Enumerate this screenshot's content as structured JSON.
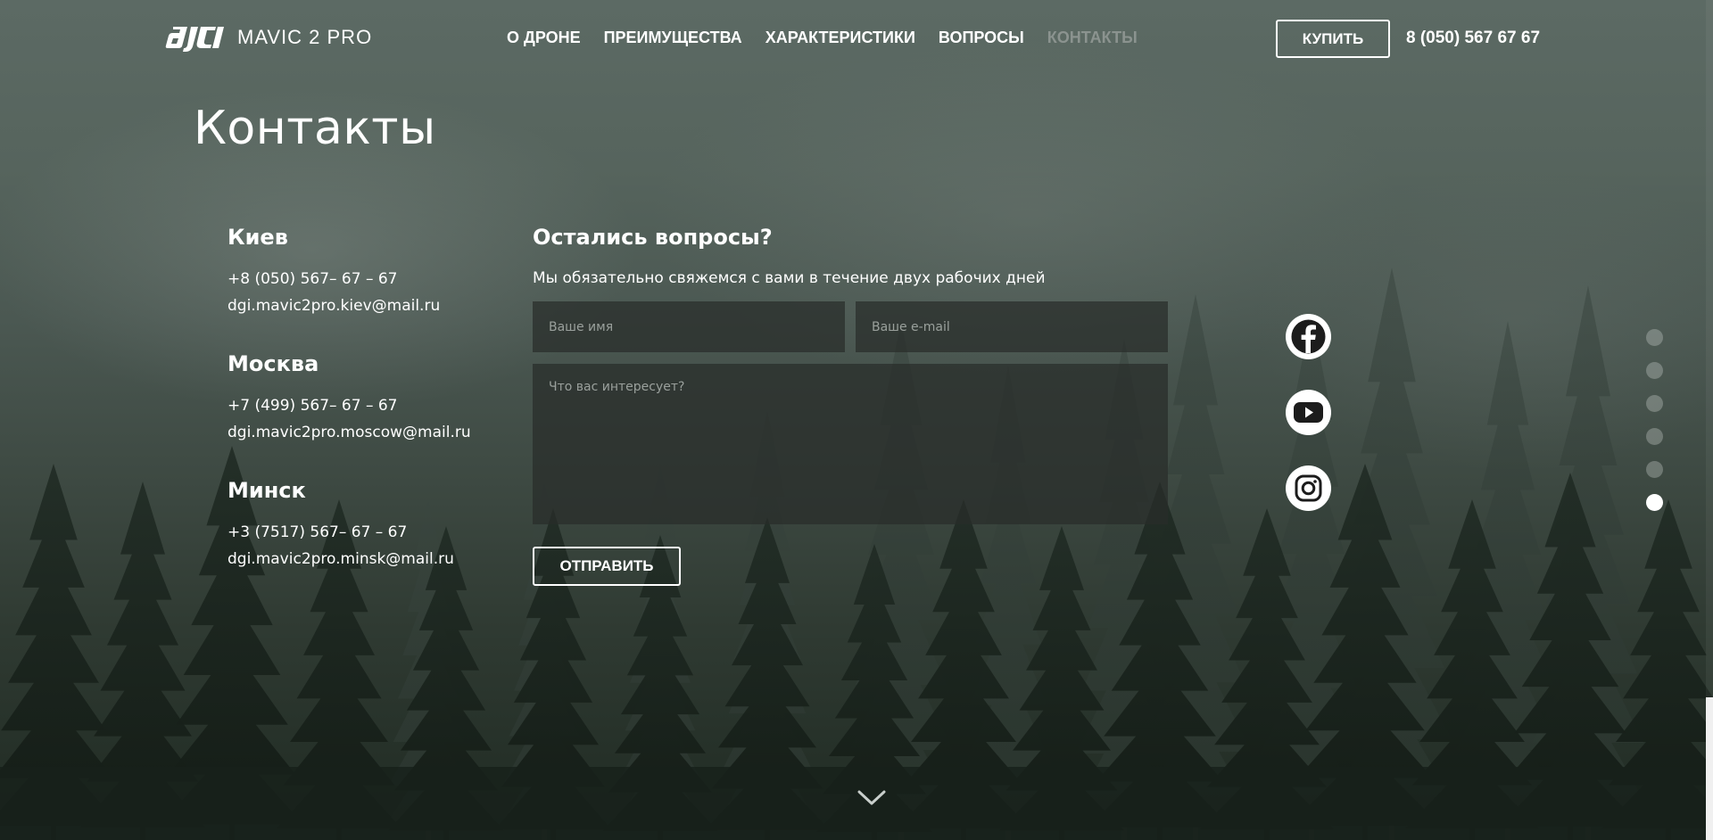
{
  "brand": {
    "logo": "dji-logo-icon",
    "product": "MAVIC 2 PRO"
  },
  "nav": {
    "items": [
      {
        "label": "О ДРОНЕ",
        "active": false
      },
      {
        "label": "ПРЕИМУЩЕСТВА",
        "active": false
      },
      {
        "label": "ХАРАКТЕРИСТИКИ",
        "active": false
      },
      {
        "label": "ВОПРОСЫ",
        "active": false
      },
      {
        "label": "КОНТАКТЫ",
        "active": true
      }
    ],
    "active_color": "#8b938f"
  },
  "header": {
    "buy_label": "КУПИТЬ",
    "phone": "8 (050) 567 67 67"
  },
  "page": {
    "title": "Контакты"
  },
  "offices": [
    {
      "city": "Киев",
      "phone": "+8 (050) 567– 67 – 67",
      "email": "dgi.mavic2pro.kiev@mail.ru"
    },
    {
      "city": "Москва",
      "phone": "+7 (499) 567– 67 – 67",
      "email": "dgi.mavic2pro.moscow@mail.ru"
    },
    {
      "city": "Минск",
      "phone": "+3 (7517) 567– 67 – 67",
      "email": "dgi.mavic2pro.minsk@mail.ru"
    }
  ],
  "form": {
    "title": "Остались вопросы?",
    "subtitle": "Мы обязательно свяжемся с вами в течение двух рабочих дней",
    "name_placeholder": "Ваше имя",
    "name_value": "",
    "email_placeholder": "Ваше e-mail",
    "email_value": "",
    "message_placeholder": "Что вас интересует?",
    "message_value": "",
    "submit_label": "ОТПРАВИТЬ"
  },
  "social": [
    {
      "icon": "facebook-icon"
    },
    {
      "icon": "youtube-icon"
    },
    {
      "icon": "instagram-icon"
    }
  ],
  "pagination": {
    "total": 6,
    "active_index": 5
  },
  "scroll_down_icon": "chevron-down-icon"
}
